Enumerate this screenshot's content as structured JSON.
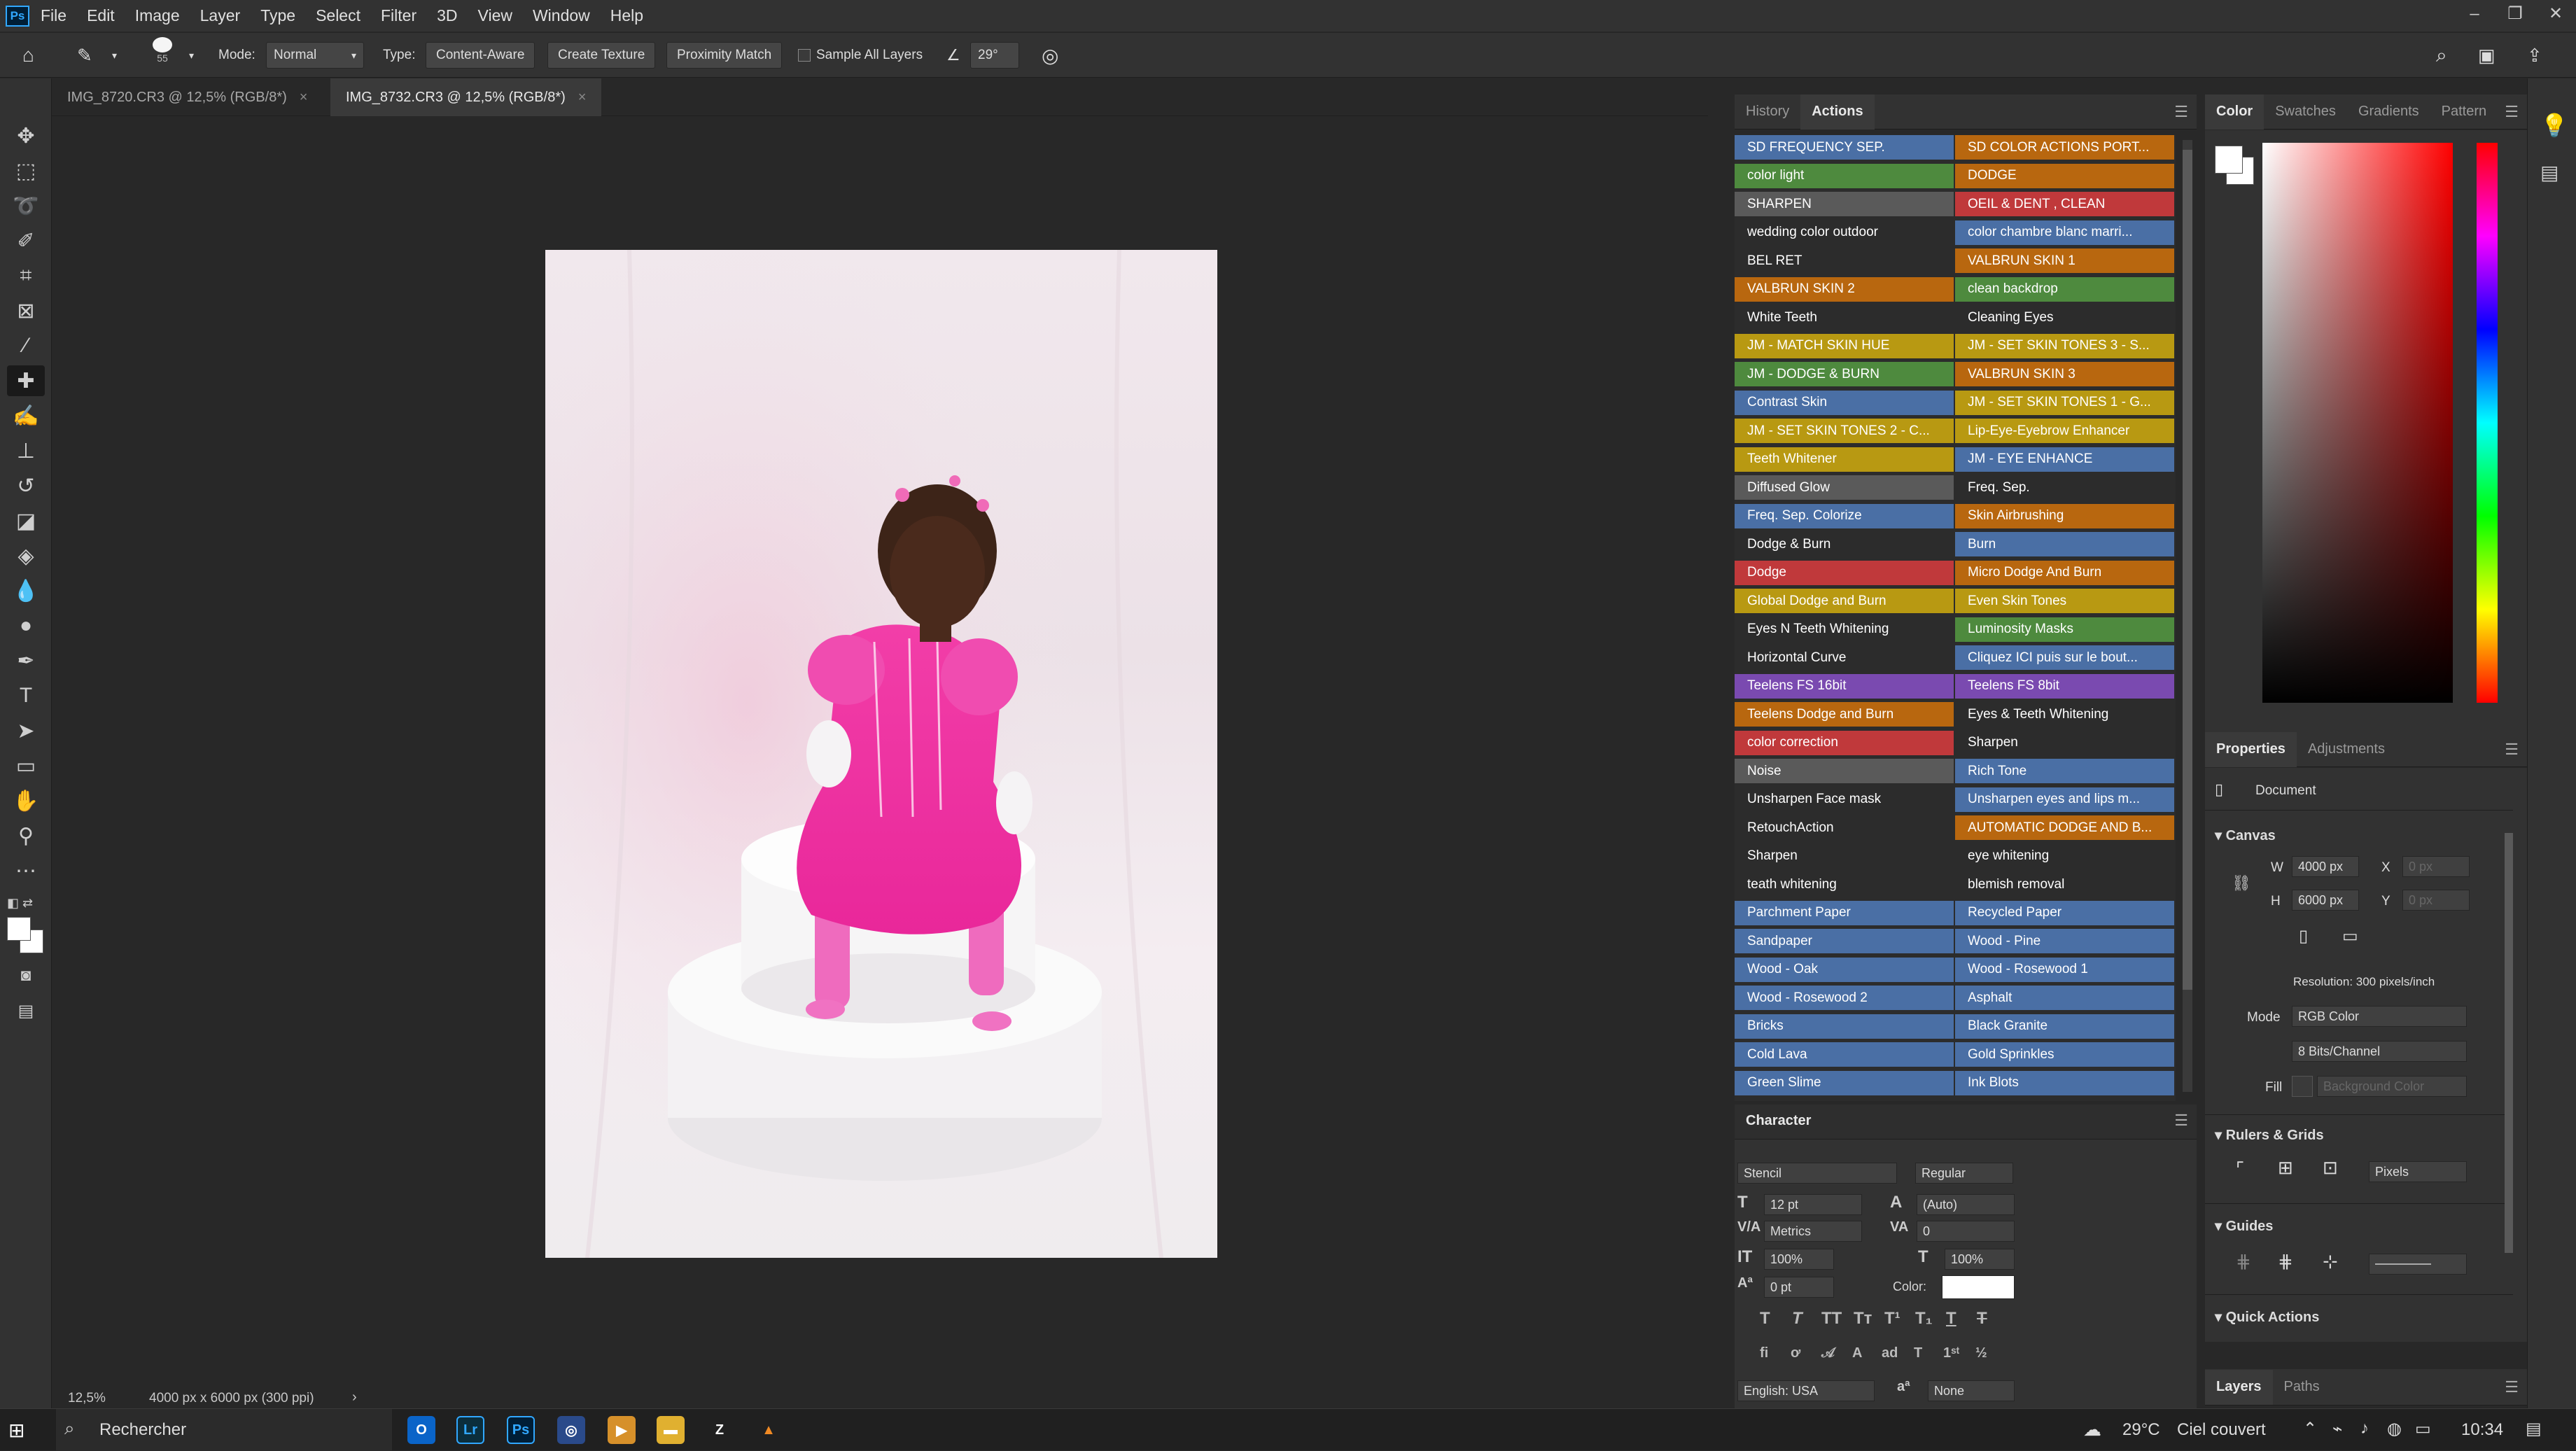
{
  "app": {
    "logo": "Ps"
  },
  "menu": [
    "File",
    "Edit",
    "Image",
    "Layer",
    "Type",
    "Select",
    "Filter",
    "3D",
    "View",
    "Window",
    "Help"
  ],
  "options": {
    "brush_size": "55",
    "mode_label": "Mode:",
    "mode_value": "Normal",
    "type_label": "Type:",
    "type_buttons": [
      "Content-Aware",
      "Create Texture",
      "Proximity Match"
    ],
    "sample_all_layers": "Sample All Layers",
    "angle": "29°"
  },
  "tabs": [
    {
      "label": "IMG_8720.CR3 @ 12,5% (RGB/8*)",
      "active": false
    },
    {
      "label": "IMG_8732.CR3 @ 12,5% (RGB/8*)",
      "active": true
    }
  ],
  "status": {
    "zoom": "12,5%",
    "doc_info": "4000 px x 6000 px (300 ppi)"
  },
  "history_panel": {
    "tabs": [
      "History",
      "Actions"
    ],
    "active": "Actions"
  },
  "actions": {
    "left": [
      {
        "label": "SD FREQUENCY SEP.",
        "color": "#4a6fa5"
      },
      {
        "label": "color light",
        "color": "#4e8a3e"
      },
      {
        "label": "SHARPEN",
        "color": "#5a5a5a"
      },
      {
        "label": "wedding color outdoor",
        "color": "#2c2c2c"
      },
      {
        "label": "BEL RET",
        "color": "#2c2c2c"
      },
      {
        "label": "VALBRUN SKIN 2",
        "color": "#b8670f"
      },
      {
        "label": "White Teeth",
        "color": "#2c2c2c"
      },
      {
        "label": "JM - MATCH SKIN HUE",
        "color": "#b89912"
      },
      {
        "label": "JM - DODGE & BURN",
        "color": "#4e8a3e"
      },
      {
        "label": "Contrast Skin",
        "color": "#4a6fa5"
      },
      {
        "label": "JM - SET SKIN TONES 2 - C...",
        "color": "#b89912"
      },
      {
        "label": "Teeth Whitener",
        "color": "#b89912"
      },
      {
        "label": "Diffused Glow",
        "color": "#5a5a5a"
      },
      {
        "label": "Freq. Sep. Colorize",
        "color": "#4a6fa5"
      },
      {
        "label": "Dodge & Burn",
        "color": "#2c2c2c"
      },
      {
        "label": "Dodge",
        "color": "#c0393b"
      },
      {
        "label": "Global Dodge and Burn",
        "color": "#b89912"
      },
      {
        "label": "Eyes N Teeth Whitening",
        "color": "#2c2c2c"
      },
      {
        "label": "Horizontal Curve",
        "color": "#2c2c2c"
      },
      {
        "label": "Teelens FS 16bit",
        "color": "#7a4ab0"
      },
      {
        "label": "Teelens Dodge and Burn",
        "color": "#b8670f"
      },
      {
        "label": "color correction",
        "color": "#c0393b"
      },
      {
        "label": "Noise",
        "color": "#5a5a5a"
      },
      {
        "label": "Unsharpen Face mask",
        "color": "#2c2c2c"
      },
      {
        "label": "RetouchAction",
        "color": "#2c2c2c"
      },
      {
        "label": "Sharpen",
        "color": "#2c2c2c"
      },
      {
        "label": "teath whitening",
        "color": "#2c2c2c"
      },
      {
        "label": "Parchment Paper",
        "color": "#4a6fa5"
      },
      {
        "label": "Sandpaper",
        "color": "#4a6fa5"
      },
      {
        "label": "Wood - Oak",
        "color": "#4a6fa5"
      },
      {
        "label": "Wood - Rosewood 2",
        "color": "#4a6fa5"
      },
      {
        "label": "Bricks",
        "color": "#4a6fa5"
      },
      {
        "label": "Cold Lava",
        "color": "#4a6fa5"
      },
      {
        "label": "Green Slime",
        "color": "#4a6fa5"
      }
    ],
    "right": [
      {
        "label": "SD COLOR ACTIONS PORT...",
        "color": "#b8670f"
      },
      {
        "label": "DODGE",
        "color": "#b8670f"
      },
      {
        "label": "OEIL & DENT , CLEAN",
        "color": "#c0393b"
      },
      {
        "label": "color chambre blanc  marri...",
        "color": "#4a6fa5"
      },
      {
        "label": "VALBRUN SKIN 1",
        "color": "#b8670f"
      },
      {
        "label": "clean backdrop",
        "color": "#4e8a3e"
      },
      {
        "label": "Cleaning Eyes",
        "color": "#2c2c2c"
      },
      {
        "label": "JM - SET SKIN TONES 3 - S...",
        "color": "#b89912"
      },
      {
        "label": "VALBRUN SKIN 3",
        "color": "#b8670f"
      },
      {
        "label": "JM - SET SKIN TONES 1 - G...",
        "color": "#b89912"
      },
      {
        "label": "Lip-Eye-Eyebrow Enhancer",
        "color": "#b89912"
      },
      {
        "label": "JM -  EYE ENHANCE",
        "color": "#4a6fa5"
      },
      {
        "label": "Freq. Sep.",
        "color": "#2c2c2c"
      },
      {
        "label": "Skin Airbrushing",
        "color": "#b8670f"
      },
      {
        "label": "Burn",
        "color": "#4a6fa5"
      },
      {
        "label": "Micro Dodge And Burn",
        "color": "#b8670f"
      },
      {
        "label": "Even Skin Tones",
        "color": "#b89912"
      },
      {
        "label": "Luminosity Masks",
        "color": "#4e8a3e"
      },
      {
        "label": "Cliquez ICI puis sur le bout...",
        "color": "#4a6fa5"
      },
      {
        "label": "Teelens FS 8bit",
        "color": "#7a4ab0"
      },
      {
        "label": "Eyes & Teeth Whitening",
        "color": "#2c2c2c"
      },
      {
        "label": "Sharpen",
        "color": "#2c2c2c"
      },
      {
        "label": "Rich Tone",
        "color": "#4a6fa5"
      },
      {
        "label": "Unsharpen eyes and lips m...",
        "color": "#4a6fa5"
      },
      {
        "label": "AUTOMATIC DODGE AND B...",
        "color": "#b8670f"
      },
      {
        "label": "eye whitening",
        "color": "#2c2c2c"
      },
      {
        "label": "blemish removal",
        "color": "#2c2c2c"
      },
      {
        "label": "Recycled Paper",
        "color": "#4a6fa5"
      },
      {
        "label": "Wood - Pine",
        "color": "#4a6fa5"
      },
      {
        "label": "Wood - Rosewood 1",
        "color": "#4a6fa5"
      },
      {
        "label": "Asphalt",
        "color": "#4a6fa5"
      },
      {
        "label": "Black Granite",
        "color": "#4a6fa5"
      },
      {
        "label": "Gold Sprinkles",
        "color": "#4a6fa5"
      },
      {
        "label": "Ink Blots",
        "color": "#4a6fa5"
      }
    ]
  },
  "character": {
    "title": "Character",
    "font": "Stencil",
    "style": "Regular",
    "size": "12 pt",
    "leading": "(Auto)",
    "kerning": "Metrics",
    "tracking": "0",
    "vscale": "100%",
    "hscale": "100%",
    "baseline": "0 pt",
    "color_label": "Color:",
    "language": "English: USA",
    "aa": "None"
  },
  "color_panel": {
    "tabs": [
      "Color",
      "Swatches",
      "Gradients",
      "Pattern"
    ],
    "active": "Color"
  },
  "properties": {
    "tabs": [
      "Properties",
      "Adjustments"
    ],
    "active": "Properties",
    "document": "Document",
    "canvas_title": "Canvas",
    "w_label": "W",
    "w_value": "4000 px",
    "h_label": "H",
    "h_value": "6000 px",
    "x_label": "X",
    "x_value": "0 px",
    "y_label": "Y",
    "y_value": "0 px",
    "resolution": "Resolution: 300 pixels/inch",
    "mode_label": "Mode",
    "mode_value": "RGB Color",
    "depth": "8 Bits/Channel",
    "fill_label": "Fill",
    "fill_value": "Background Color",
    "rulers_title": "Rulers & Grids",
    "units": "Pixels",
    "guides_title": "Guides",
    "quick_title": "Quick Actions"
  },
  "layers_tabs": [
    "Layers",
    "Paths"
  ],
  "taskbar": {
    "search": "Rechercher",
    "temperature": "29°C",
    "weather": "Ciel couvert",
    "time": "10:34"
  }
}
